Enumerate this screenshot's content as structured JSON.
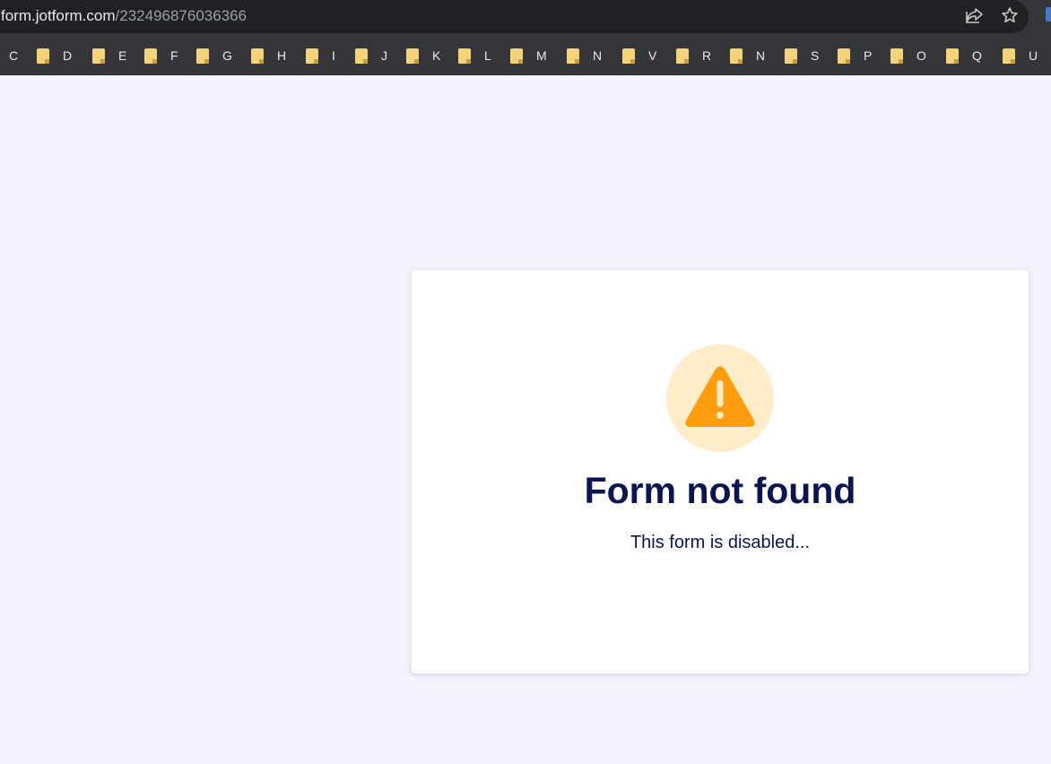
{
  "browser": {
    "url_host": "form.jotform.com",
    "url_path": "/232496876036366",
    "icons": {
      "lock": "lock-icon",
      "share": "share-icon",
      "bookmark": "star-icon",
      "extension": "extension-icon"
    }
  },
  "bookmarks": [
    {
      "label": "C",
      "folder": false
    },
    {
      "label": "D",
      "folder": true
    },
    {
      "label": "E",
      "folder": true
    },
    {
      "label": "F",
      "folder": true
    },
    {
      "label": "G",
      "folder": true
    },
    {
      "label": "H",
      "folder": true
    },
    {
      "label": "I",
      "folder": true
    },
    {
      "label": "J",
      "folder": true
    },
    {
      "label": "K",
      "folder": true
    },
    {
      "label": "L",
      "folder": true
    },
    {
      "label": "M",
      "folder": true
    },
    {
      "label": "N",
      "folder": true
    },
    {
      "label": "V",
      "folder": true
    },
    {
      "label": "R",
      "folder": true
    },
    {
      "label": "N",
      "folder": true
    },
    {
      "label": "S",
      "folder": true
    },
    {
      "label": "P",
      "folder": true
    },
    {
      "label": "O",
      "folder": true
    },
    {
      "label": "Q",
      "folder": true
    },
    {
      "label": "U",
      "folder": true
    }
  ],
  "page": {
    "title": "Form not found",
    "message": "This form is disabled...",
    "icon": "warning-icon",
    "colors": {
      "background": "#f3f3fe",
      "card": "#ffffff",
      "text": "#0a1551",
      "warning": "#ff9d0f",
      "warning_bg": "#ffecc8"
    }
  }
}
